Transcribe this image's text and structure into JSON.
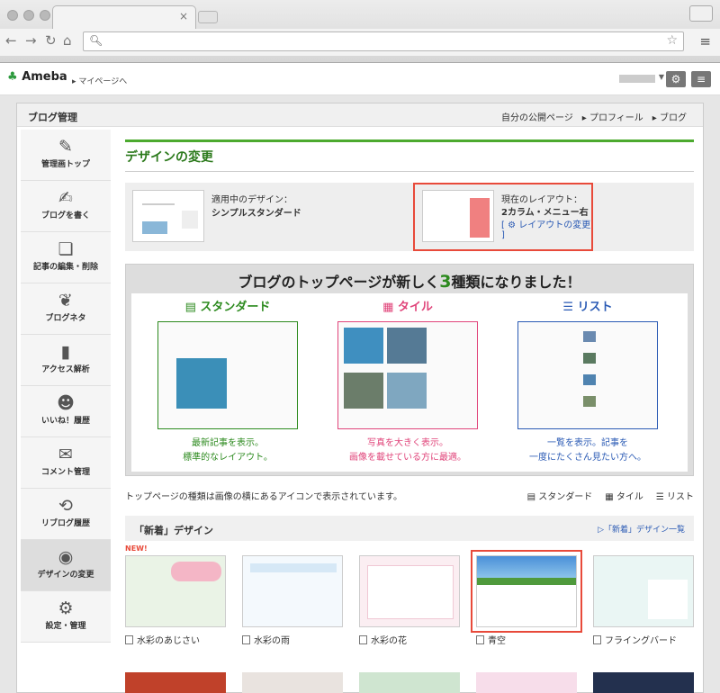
{
  "browser": {
    "tab_close": "×"
  },
  "header": {
    "logo_name": "Ameba",
    "mypage": "▸ マイページへ"
  },
  "blog_admin": {
    "title": "ブログ管理",
    "links": [
      "自分の公開ページ",
      "▸ プロフィール",
      "▸ ブログ"
    ]
  },
  "sidebar": {
    "items": [
      {
        "label": "管理画トップ",
        "icon": "pencil-icon",
        "glyph": "✎"
      },
      {
        "label": "ブログを書く",
        "icon": "edit-icon",
        "glyph": "✍"
      },
      {
        "label": "記事の編集・削除",
        "icon": "folders-icon",
        "glyph": "❏"
      },
      {
        "label": "ブログネタ",
        "icon": "sprout-icon",
        "glyph": "❦"
      },
      {
        "label": "アクセス解析",
        "icon": "bar-chart-icon",
        "glyph": "▮"
      },
      {
        "label": "いいね！履歴",
        "icon": "smiley-icon",
        "glyph": "☻"
      },
      {
        "label": "コメント管理",
        "icon": "speech-bubble-icon",
        "glyph": "✉"
      },
      {
        "label": "リブログ履歴",
        "icon": "reblog-icon",
        "glyph": "⟲"
      },
      {
        "label": "デザインの変更",
        "icon": "palette-icon",
        "glyph": "◉"
      },
      {
        "label": "設定・管理",
        "icon": "gear-icon",
        "glyph": "⚙"
      }
    ]
  },
  "main": {
    "title": "デザインの変更",
    "current_design": {
      "label": "適用中のデザイン：",
      "name": "シンプルスタンダード"
    },
    "current_layout": {
      "label": "現在のレイアウト：",
      "name": "2カラム・メニュー右",
      "change": "[ ⚙ レイアウトの変更 ]"
    },
    "banner": {
      "before": "ブログのトップページが新しく",
      "num": "3",
      "after": "種類になりました！",
      "cols": [
        {
          "name": "▤ スタンダード",
          "color": "#2c8a1e",
          "lines": [
            "最新記事を表示。",
            "標準的なレイアウト。"
          ]
        },
        {
          "name": "▦ タイル",
          "color": "#e0447a",
          "lines": [
            "写真を大きく表示。",
            "画像を載せている方に最適。"
          ]
        },
        {
          "name": "☰ リスト",
          "color": "#2a5ab4",
          "lines": [
            "一覧を表示。記事を",
            "一度にたくさん見たい方へ。"
          ]
        }
      ]
    },
    "type_desc": "トップページの種類は画像の横にあるアイコンで表示されています。",
    "type_legend": [
      "▤ スタンダード",
      "▦ タイル",
      "☰ リスト"
    ],
    "new_designs": {
      "title": "「新着」デザイン",
      "link": "▷「新着」デザイン一覧",
      "new_badge": "NEW!",
      "items": [
        {
          "name": "水彩のあじさい",
          "bg": "#eaf3e6"
        },
        {
          "name": "水彩の雨",
          "bg": "#f4f9fd"
        },
        {
          "name": "水彩の花",
          "bg": "#fbeef2"
        },
        {
          "name": "青空",
          "bg": "#6aa5e0",
          "selected": true
        },
        {
          "name": "フライングバード",
          "bg": "#eaf6f4"
        }
      ]
    },
    "row2_colors": [
      "#c0412a",
      "#e9e3df",
      "#cfe5d0",
      "#f7ddea",
      "#23304e"
    ]
  }
}
